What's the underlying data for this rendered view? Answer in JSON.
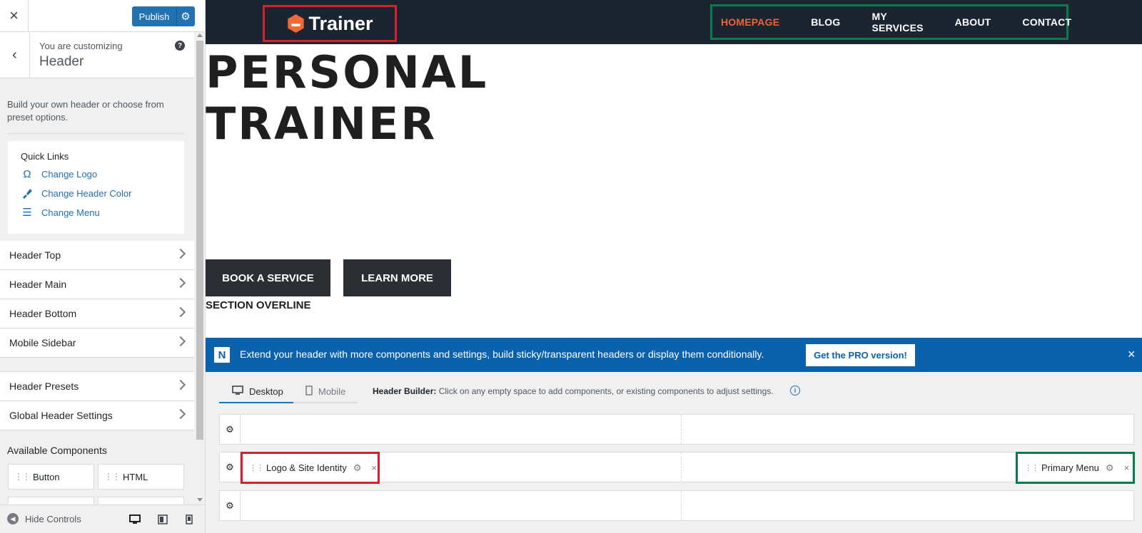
{
  "sidebar": {
    "close_icon": "×",
    "publish_label": "Publish",
    "customizing_label": "You are customizing",
    "customizing_title": "Header",
    "help_icon": "?",
    "description": "Build your own header or choose from preset options.",
    "quick_links": {
      "title": "Quick Links",
      "items": [
        {
          "label": "Change Logo",
          "icon": "omega-icon"
        },
        {
          "label": "Change Header Color",
          "icon": "brush-icon"
        },
        {
          "label": "Change Menu",
          "icon": "menu-icon"
        }
      ]
    },
    "sections": [
      {
        "label": "Header Top"
      },
      {
        "label": "Header Main"
      },
      {
        "label": "Header Bottom"
      },
      {
        "label": "Mobile Sidebar"
      }
    ],
    "sections2": [
      {
        "label": "Header Presets"
      },
      {
        "label": "Global Header Settings"
      }
    ],
    "available_components": {
      "title": "Available Components",
      "items": [
        {
          "label": "Button"
        },
        {
          "label": "HTML"
        }
      ]
    },
    "footer": {
      "hide_controls_label": "Hide Controls"
    }
  },
  "site": {
    "logo_text": "Trainer",
    "nav": [
      {
        "label": "HOMEPAGE",
        "active": true
      },
      {
        "label": "BLOG",
        "active": false
      },
      {
        "label": "MY SERVICES",
        "active": false
      },
      {
        "label": "ABOUT",
        "active": false
      },
      {
        "label": "CONTACT",
        "active": false
      }
    ],
    "hero_line1": "PERSONAL",
    "hero_line2": "TRAINER",
    "buttons": [
      {
        "label": "BOOK A SERVICE"
      },
      {
        "label": "LEARN MORE"
      }
    ],
    "section_overline": "SECTION OVERLINE"
  },
  "builder": {
    "promo_text": "Extend your header with more components and settings, build sticky/transparent headers or display them conditionally.",
    "promo_button": "Get the PRO version!",
    "promo_close": "×",
    "tabs": [
      {
        "label": "Desktop",
        "active": true
      },
      {
        "label": "Mobile",
        "active": false
      }
    ],
    "hint_bold": "Header Builder:",
    "hint_text": " Click on any empty space to add components, or existing components to adjust settings.",
    "components": {
      "logo": "Logo & Site Identity",
      "menu": "Primary Menu"
    }
  },
  "colors": {
    "wp_blue": "#2271b1",
    "header_bg": "#1b2531",
    "nav_active": "#f0623a",
    "logo_accent": "#f06a35",
    "promo_blue": "#0a62ad",
    "highlight_red": "#d8202a",
    "highlight_green": "#0a7c4a"
  }
}
